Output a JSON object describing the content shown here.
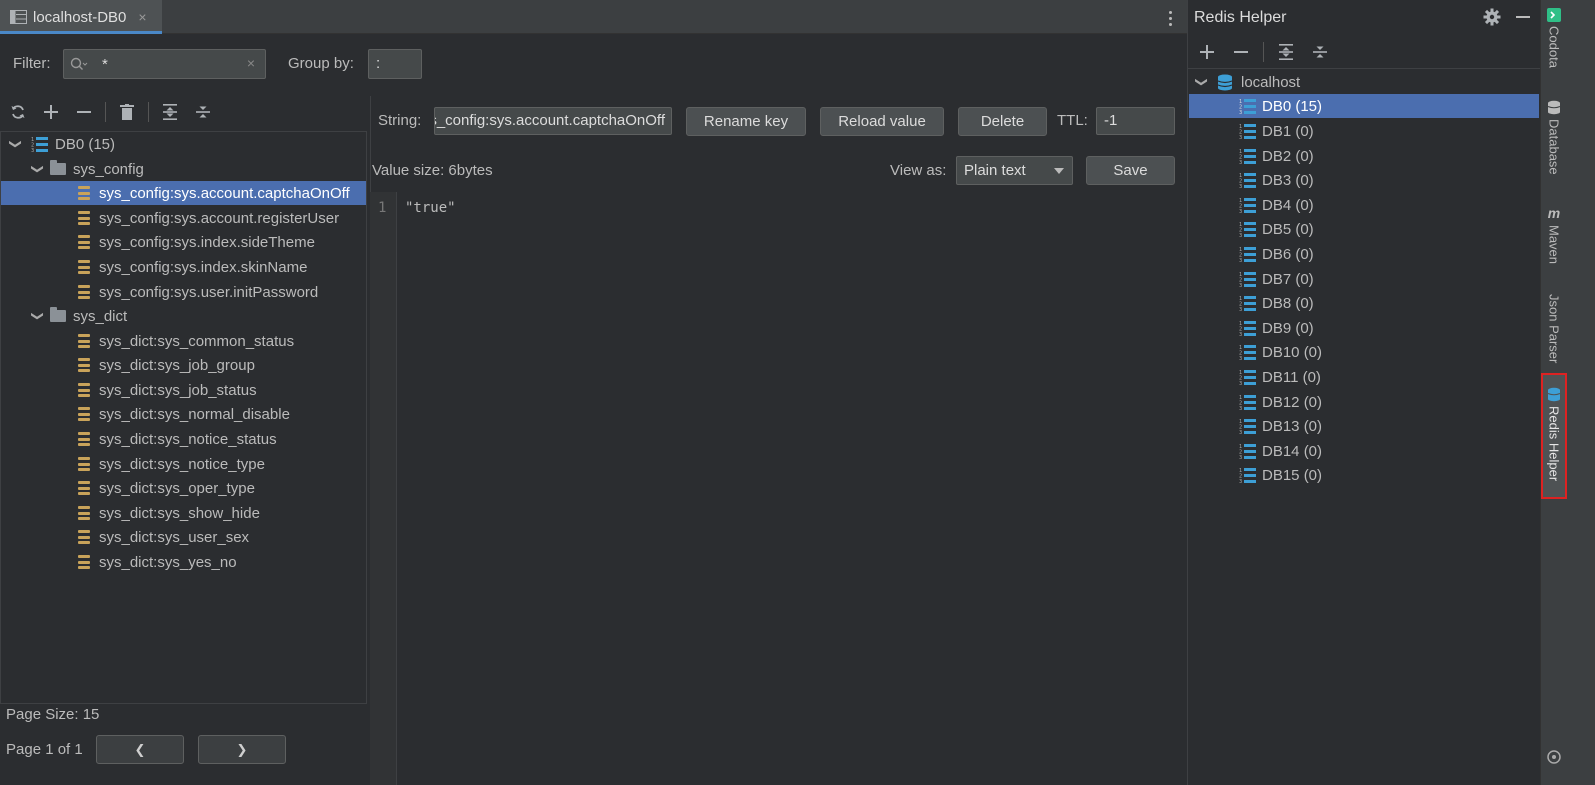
{
  "tab": {
    "title": "localhost-DB0",
    "close": "×"
  },
  "filter": {
    "label": "Filter:",
    "value": "*",
    "clear": "×"
  },
  "groupby": {
    "label": "Group by:",
    "value": ":"
  },
  "tree": {
    "root": "DB0 (15)",
    "folders": [
      {
        "name": "sys_config",
        "keys": [
          "sys_config:sys.account.captchaOnOff",
          "sys_config:sys.account.registerUser",
          "sys_config:sys.index.sideTheme",
          "sys_config:sys.index.skinName",
          "sys_config:sys.user.initPassword"
        ]
      },
      {
        "name": "sys_dict",
        "keys": [
          "sys_dict:sys_common_status",
          "sys_dict:sys_job_group",
          "sys_dict:sys_job_status",
          "sys_dict:sys_normal_disable",
          "sys_dict:sys_notice_status",
          "sys_dict:sys_notice_type",
          "sys_dict:sys_oper_type",
          "sys_dict:sys_show_hide",
          "sys_dict:sys_user_sex",
          "sys_dict:sys_yes_no"
        ]
      }
    ],
    "selected_key": "sys_config:sys.account.captchaOnOff"
  },
  "pagination": {
    "page_size": "Page Size: 15",
    "page_of": "Page 1 of 1",
    "prev": "❮",
    "next": "❯"
  },
  "editor": {
    "string_label": "String:",
    "key_value": "sys_config:sys.account.captchaOnOff",
    "rename_label": "Rename key",
    "reload_label": "Reload value",
    "delete_label": "Delete",
    "ttl_label": "TTL:",
    "ttl_value": "-1",
    "value_size": "Value size: 6bytes",
    "view_as_label": "View as:",
    "view_as_value": "Plain text",
    "save_label": "Save",
    "line_number": "1",
    "content": "\"true\""
  },
  "redis_helper": {
    "title": "Redis Helper",
    "connection": "localhost",
    "databases": [
      "DB0 (15)",
      "DB1 (0)",
      "DB2 (0)",
      "DB3 (0)",
      "DB4 (0)",
      "DB5 (0)",
      "DB6 (0)",
      "DB7 (0)",
      "DB8 (0)",
      "DB9 (0)",
      "DB10 (0)",
      "DB11 (0)",
      "DB12 (0)",
      "DB13 (0)",
      "DB14 (0)",
      "DB15 (0)"
    ],
    "selected_db": "DB0 (15)"
  },
  "side_tabs": [
    "Codota",
    "Database",
    "Maven",
    "Json Parser",
    "Redis Helper"
  ],
  "colors": {
    "selection": "#4b6eaf",
    "key_icon": "#c9a35a",
    "db_icon": "#3d9fd6",
    "highlight_border": "#dd2222"
  }
}
